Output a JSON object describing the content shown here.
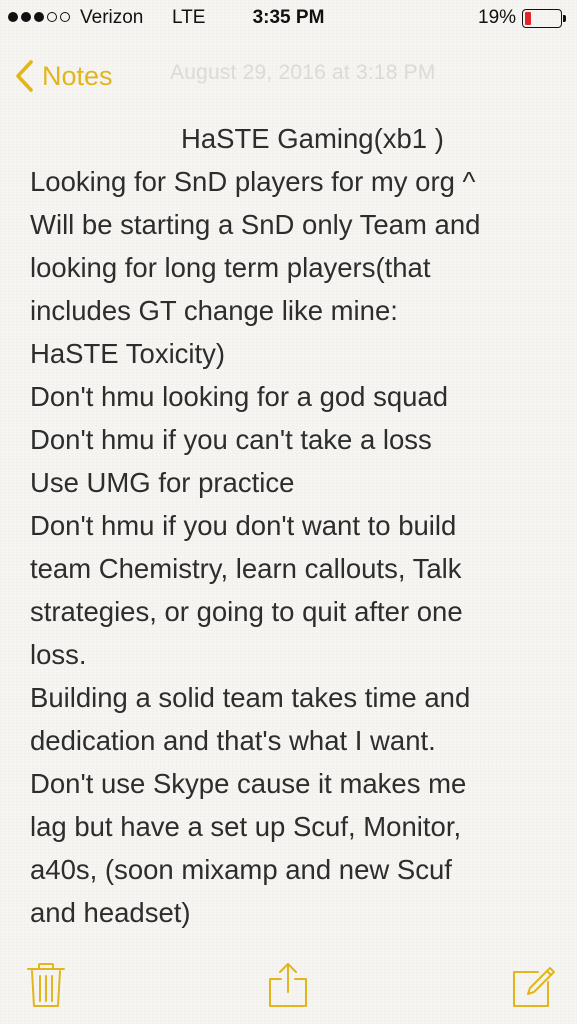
{
  "status_bar": {
    "carrier": "Verizon",
    "network": "LTE",
    "time": "3:35 PM",
    "battery_percent": "19%",
    "signal_bars": 3,
    "signal_total": 5,
    "battery_level": 0.19,
    "battery_color": "#e0262b"
  },
  "nav": {
    "back_label": "Notes",
    "date_faint": "August 29, 2016 at 3:18 PM",
    "accent_color": "#e2b51d"
  },
  "note": {
    "lines": [
      "HaSTE Gaming(xb1 )",
      "Looking for SnD players for my org ^",
      "Will be starting a SnD only Team and",
      "looking for long term players(that",
      "includes GT change like mine:",
      "HaSTE Toxicity)",
      "Don't hmu looking for a god squad",
      "Don't hmu if you can't take a loss",
      "Use UMG for practice",
      "Don't hmu if you don't want to build",
      "team Chemistry, learn callouts, Talk",
      "strategies, or going to quit after one",
      "loss.",
      "Building a solid team takes time and",
      "dedication and that's what I want.",
      "Don't use Skype cause it makes me",
      "lag but have a set up Scuf, Monitor,",
      "a40s, (soon mixamp and new Scuf",
      "and headset)"
    ]
  },
  "toolbar": {
    "icons": [
      "trash-icon",
      "share-icon",
      "compose-icon"
    ]
  }
}
